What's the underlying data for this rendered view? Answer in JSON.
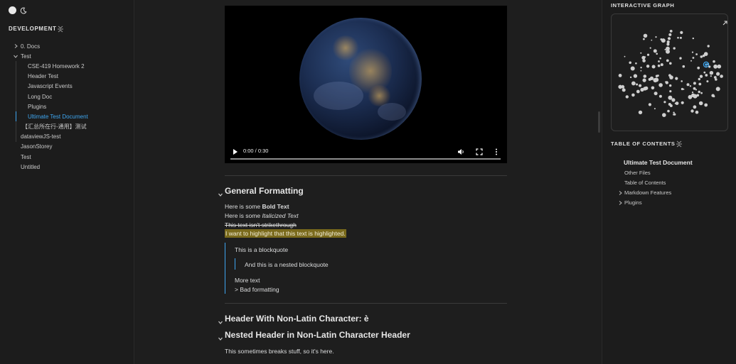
{
  "sidebar": {
    "section_title": "DEVELOPMENT",
    "items": [
      {
        "label": "0. Docs",
        "level": 0,
        "chevron": "right"
      },
      {
        "label": "Test",
        "level": 0,
        "chevron": "down"
      },
      {
        "label": "CSE-419 Homework 2",
        "level": 1
      },
      {
        "label": "Header Test",
        "level": 1
      },
      {
        "label": "Javascript Events",
        "level": 1
      },
      {
        "label": "Long Doc",
        "level": 1
      },
      {
        "label": "Plugins",
        "level": 1
      },
      {
        "label": "Ultimate Test Document",
        "level": 1,
        "active": true
      },
      {
        "label": "【汇总所在行-通用】测试",
        "level": 0
      },
      {
        "label": "dataviewJS-test",
        "level": 0
      },
      {
        "label": "JasonStorey",
        "level": 0
      },
      {
        "label": "Test",
        "level": 0
      },
      {
        "label": "Untitled",
        "level": 0
      }
    ]
  },
  "video": {
    "time": "0:00 / 0:30"
  },
  "content": {
    "h_general": "General Formatting",
    "bold_prefix": "Here is some ",
    "bold_text": "Bold Text",
    "italic_prefix": "Here is some ",
    "italic_text": "Italicized Text",
    "strike_text": "This text isn't strikethrough",
    "highlight_text": "I want to highlight that this text is highlighted.",
    "blockquote": "This is a blockquote",
    "nested_blockquote": "And this is a nested blockquote",
    "more_text": "More text",
    "bad_formatting": "> Bad formatting",
    "h_nonlatin": "Header With Non-Latin Character: è",
    "h_nested": "Nested Header in Non-Latin Character Header",
    "breaks_text": "This sometimes breaks stuff, so it's here."
  },
  "right": {
    "graph_title": "INTERACTIVE GRAPH",
    "toc_title": "TABLE OF CONTENTS",
    "toc": [
      {
        "label": "Ultimate Test Document",
        "type": "h1"
      },
      {
        "label": "Other Files",
        "type": "h2"
      },
      {
        "label": "Table of Contents",
        "type": "h2"
      },
      {
        "label": "Markdown Features",
        "type": "h2-collapsed"
      },
      {
        "label": "Plugins",
        "type": "h2-collapsed"
      }
    ]
  },
  "colors": {
    "accent": "#3ea6f0",
    "highlight": "#7a6a1c",
    "background": "#1e1e1e"
  }
}
